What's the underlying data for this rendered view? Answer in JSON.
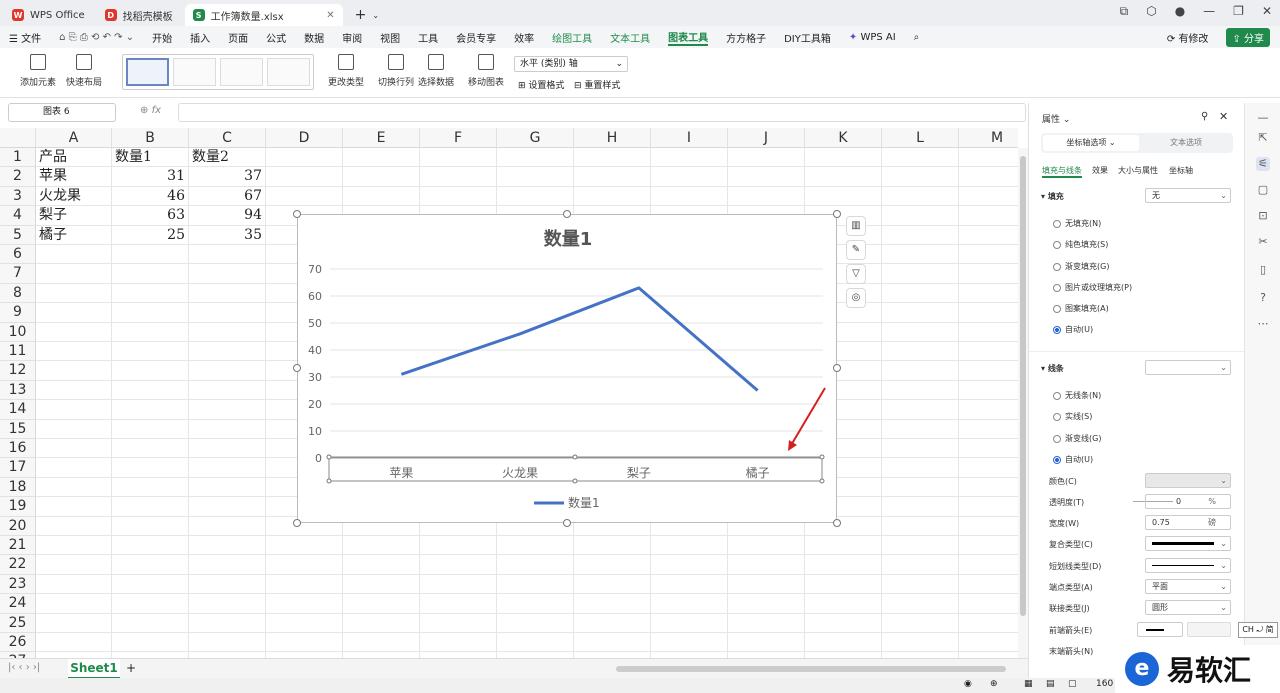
{
  "tabs": [
    {
      "label": "WPS Office",
      "logo": "W",
      "color": "#e0362c"
    },
    {
      "label": "找稻壳模板",
      "logo": "D",
      "color": "#e0362c"
    },
    {
      "label": "工作簿数量.xlsx",
      "logo": "S",
      "color": "#1f8a4c"
    }
  ],
  "menu": {
    "file": "文件",
    "items": [
      "开始",
      "插入",
      "页面",
      "公式",
      "数据",
      "审阅",
      "视图",
      "工具",
      "会员专享",
      "效率"
    ],
    "context": [
      "绘图工具",
      "文本工具"
    ],
    "active": "图表工具",
    "extra": [
      "方方格子",
      "DIY工具箱"
    ],
    "wps_ai": "WPS AI",
    "changes": "有修改",
    "share": "分享"
  },
  "ribbon": {
    "add_element": "添加元素",
    "quick_layout": "快速布局",
    "change_type": "更改类型",
    "switch_rowcol": "切换行列",
    "select_data": "选择数据",
    "move_chart": "移动图表",
    "axis_select": "水平 (类别) 轴",
    "set_format": "设置格式",
    "reset_style": "重置样式"
  },
  "formula_bar": {
    "name_box": "图表 6",
    "fx": "fx"
  },
  "columns": [
    "A",
    "B",
    "C",
    "D",
    "E",
    "F",
    "G",
    "H",
    "I",
    "J",
    "K",
    "L",
    "M"
  ],
  "rows": [
    "1",
    "2",
    "3",
    "4",
    "5",
    "6",
    "7",
    "8",
    "9",
    "10",
    "11",
    "12",
    "13",
    "14",
    "15",
    "16",
    "17",
    "18",
    "19",
    "20",
    "21",
    "22",
    "23",
    "24",
    "25",
    "26",
    "27"
  ],
  "cells": {
    "A1": "产品",
    "B1": "数量1",
    "C1": "数量2",
    "A2": "苹果",
    "B2": "31",
    "C2": "37",
    "A3": "火龙果",
    "B3": "46",
    "C3": "67",
    "A4": "梨子",
    "B4": "63",
    "C4": "94",
    "A5": "橘子",
    "B5": "25",
    "C5": "35"
  },
  "chart_data": {
    "type": "line",
    "title": "数量1",
    "categories": [
      "苹果",
      "火龙果",
      "梨子",
      "橘子"
    ],
    "series": [
      {
        "name": "数量1",
        "values": [
          31,
          46,
          63,
          25
        ],
        "color": "#4472c4"
      }
    ],
    "ylim": [
      0,
      70
    ],
    "yticks": [
      "0",
      "10",
      "20",
      "30",
      "40",
      "50",
      "60",
      "70"
    ],
    "grid": true,
    "legend": "bottom"
  },
  "sheet": {
    "name": "Sheet1"
  },
  "status": {
    "zoom": "160"
  },
  "pane": {
    "title": "属性",
    "tab_active": "坐标轴选项",
    "tab_other": "文本选项",
    "subtabs": [
      "填充与线条",
      "效果",
      "大小与属性",
      "坐标轴"
    ],
    "fill_label": "填充",
    "fill_value": "无",
    "fill_options": [
      "无填充(N)",
      "纯色填充(S)",
      "渐变填充(G)",
      "图片或纹理填充(P)",
      "图案填充(A)",
      "自动(U)"
    ],
    "line_label": "线条",
    "line_options": [
      "无线条(N)",
      "实线(S)",
      "渐变线(G)",
      "自动(U)"
    ],
    "color_label": "颜色(C)",
    "transparency_label": "透明度(T)",
    "transparency_value": "0",
    "transparency_unit": "%",
    "width_label": "宽度(W)",
    "width_value": "0.75",
    "width_unit": "磅",
    "compound_label": "复合类型(C)",
    "dash_label": "短划线类型(D)",
    "cap_label": "端点类型(A)",
    "cap_value": "平面",
    "join_label": "联接类型(J)",
    "join_value": "圆形",
    "begin_arrow_label": "前端箭头(E)",
    "end_arrow_label": "末端箭头(N)"
  },
  "ime": "CH ⤾ 简",
  "watermark": "易软汇",
  "annotation_color": "#d42020"
}
